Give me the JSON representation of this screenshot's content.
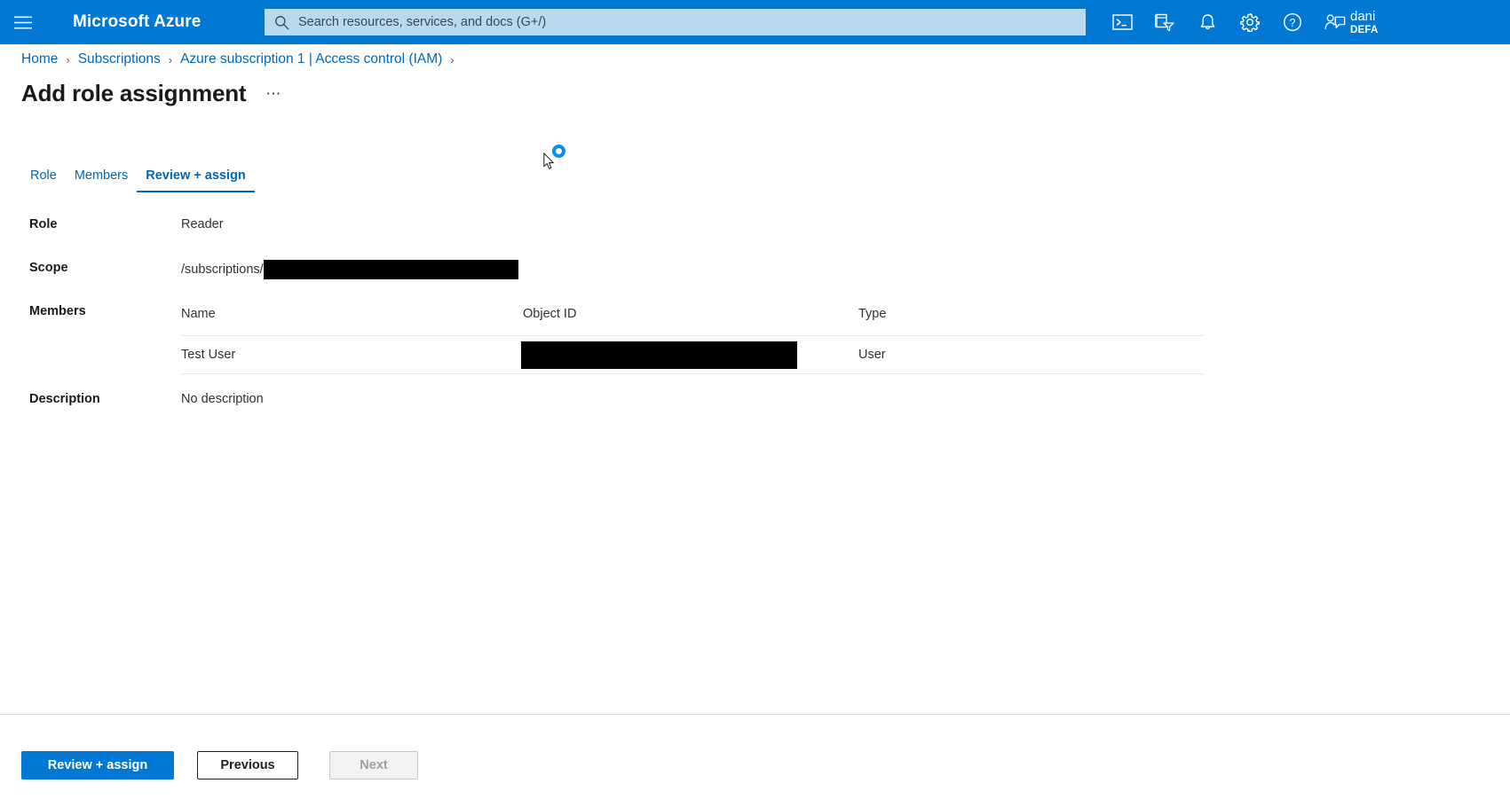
{
  "header": {
    "brand": "Microsoft Azure",
    "menu_icon": "hamburger-icon",
    "search": {
      "placeholder": "Search resources, services, and docs (G+/)",
      "value": "",
      "icon": "search-icon"
    },
    "icons": [
      {
        "name": "cloud-shell-icon",
        "title": "Cloud Shell"
      },
      {
        "name": "directories-subscriptions-icon",
        "title": "Directories + subscriptions"
      },
      {
        "name": "notifications-bell-icon",
        "title": "Notifications"
      },
      {
        "name": "settings-gear-icon",
        "title": "Settings"
      },
      {
        "name": "help-question-icon",
        "title": "Help"
      },
      {
        "name": "feedback-person-icon",
        "title": "Feedback"
      }
    ],
    "account": {
      "name": "dani",
      "org": "DEFA"
    },
    "accent_color": "#0078d4",
    "search_bg": "#b9d9f0"
  },
  "breadcrumb": {
    "items": [
      {
        "label": "Home",
        "link": true
      },
      {
        "label": "Subscriptions",
        "link": true
      },
      {
        "label": "Azure subscription 1 | Access control (IAM)",
        "link": true
      }
    ],
    "separator": "›",
    "trailing_separator": "›",
    "link_color": "#0067b8"
  },
  "page": {
    "title": "Add role assignment",
    "more_actions": "⋯"
  },
  "tabs": [
    {
      "label": "Role",
      "active": false
    },
    {
      "label": "Members",
      "active": false
    },
    {
      "label": "Review + assign",
      "active": true
    }
  ],
  "form": {
    "role": {
      "label": "Role",
      "value": "Reader"
    },
    "scope": {
      "label": "Scope",
      "prefix": "/subscriptions/",
      "redacted": true
    },
    "members": {
      "label": "Members",
      "columns": [
        "Name",
        "Object ID",
        "Type"
      ],
      "rows": [
        {
          "name": "Test User",
          "object_id": "",
          "object_id_redacted": true,
          "type": "User"
        }
      ]
    },
    "description": {
      "label": "Description",
      "value": "No description"
    }
  },
  "cursor": {
    "state": "busy-spinner",
    "spinner_color": "#0a8fe8"
  },
  "footer": {
    "primary": {
      "label": "Review + assign",
      "disabled": false
    },
    "secondary": {
      "label": "Previous",
      "disabled": false
    },
    "tertiary": {
      "label": "Next",
      "disabled": true
    }
  }
}
